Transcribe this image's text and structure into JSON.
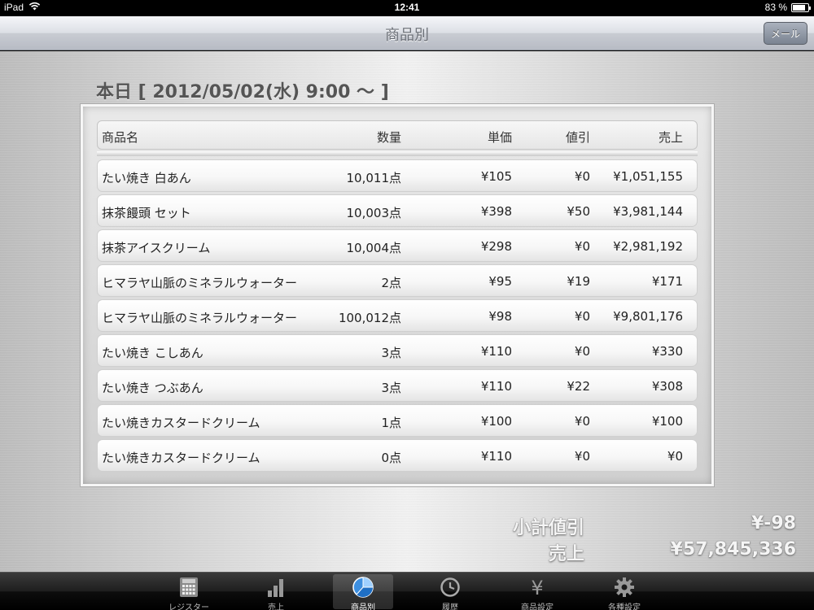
{
  "status_bar": {
    "device": "iPad",
    "time": "12:41",
    "battery": "83 %",
    "battery_level": 0.83
  },
  "nav": {
    "title": "商品別",
    "mail_button": "メール"
  },
  "date_heading": "本日 [ 2012/05/02(水)  9:00 〜 ]",
  "table": {
    "headers": {
      "name": "商品名",
      "qty": "数量",
      "price": "単価",
      "discount": "値引",
      "sales": "売上"
    },
    "rows": [
      {
        "name": "たい焼き 白あん",
        "qty": "10,011点",
        "price": "¥105",
        "discount": "¥0",
        "sales": "¥1,051,155"
      },
      {
        "name": "抹茶饅頭 セット",
        "qty": "10,003点",
        "price": "¥398",
        "discount": "¥50",
        "sales": "¥3,981,144"
      },
      {
        "name": "抹茶アイスクリーム",
        "qty": "10,004点",
        "price": "¥298",
        "discount": "¥0",
        "sales": "¥2,981,192"
      },
      {
        "name": "ヒマラヤ山脈のミネラルウォーター",
        "qty": "2点",
        "price": "¥95",
        "discount": "¥19",
        "sales": "¥171"
      },
      {
        "name": "ヒマラヤ山脈のミネラルウォーター",
        "qty": "100,012点",
        "price": "¥98",
        "discount": "¥0",
        "sales": "¥9,801,176"
      },
      {
        "name": "たい焼き こしあん",
        "qty": "3点",
        "price": "¥110",
        "discount": "¥0",
        "sales": "¥330"
      },
      {
        "name": "たい焼き つぶあん",
        "qty": "3点",
        "price": "¥110",
        "discount": "¥22",
        "sales": "¥308"
      },
      {
        "name": "たい焼きカスタードクリーム",
        "qty": "1点",
        "price": "¥100",
        "discount": "¥0",
        "sales": "¥100"
      },
      {
        "name": "たい焼きカスタードクリーム",
        "qty": "0点",
        "price": "¥110",
        "discount": "¥0",
        "sales": "¥0"
      }
    ]
  },
  "summary": {
    "discount_label": "小計値引",
    "discount_value": "¥-98",
    "sales_label": "売上",
    "sales_value": "¥57,845,336"
  },
  "tabs": [
    {
      "label": "レジスター",
      "icon": "calculator-icon",
      "active": false
    },
    {
      "label": "売上",
      "icon": "bar-chart-icon",
      "active": false
    },
    {
      "label": "商品別",
      "icon": "pie-chart-icon",
      "active": true
    },
    {
      "label": "履歴",
      "icon": "clock-icon",
      "active": false
    },
    {
      "label": "商品設定",
      "icon": "yen-icon",
      "active": false
    },
    {
      "label": "各種設定",
      "icon": "gear-icon",
      "active": false
    }
  ]
}
